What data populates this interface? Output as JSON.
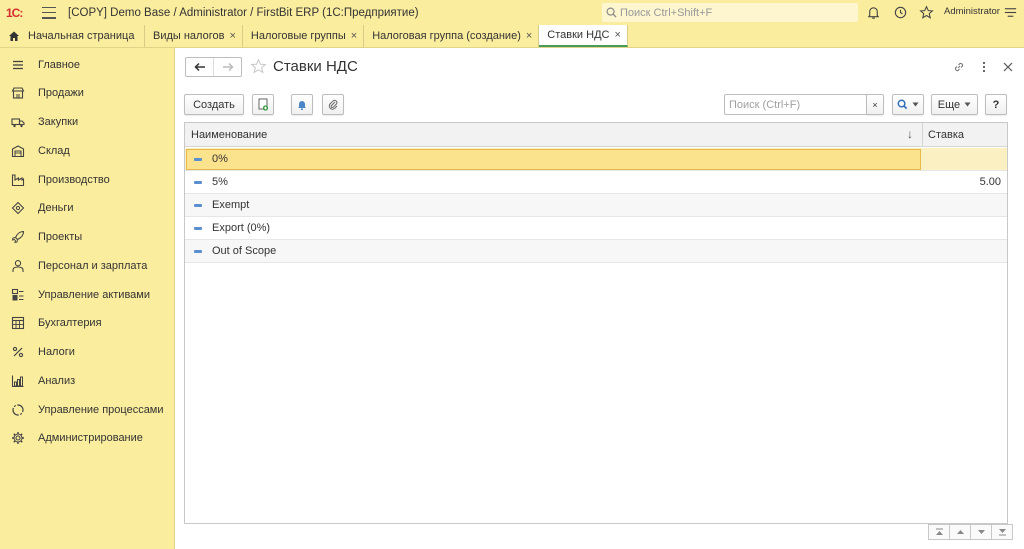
{
  "app": {
    "logo_text": "1С:",
    "title": "[COPY] Demo Base / Administrator / FirstBit ERP  (1С:Предприятие)",
    "search_placeholder": "Поиск Ctrl+Shift+F",
    "user": "Administrator"
  },
  "tabs": [
    {
      "label": "Начальная страница",
      "icon": "home-icon",
      "closable": false
    },
    {
      "label": "Виды налогов",
      "closable": true
    },
    {
      "label": "Налоговые группы",
      "closable": true
    },
    {
      "label": "Налоговая группа (создание)",
      "closable": true
    },
    {
      "label": "Ставки НДС",
      "closable": true,
      "active": true
    }
  ],
  "tab_close_glyph": "×",
  "sidebar": {
    "items": [
      {
        "label": "Главное",
        "icon": "menu-icon"
      },
      {
        "label": "Продажи",
        "icon": "shop-icon"
      },
      {
        "label": "Закупки",
        "icon": "truck-icon"
      },
      {
        "label": "Склад",
        "icon": "warehouse-icon"
      },
      {
        "label": "Производство",
        "icon": "factory-icon"
      },
      {
        "label": "Деньги",
        "icon": "money-icon"
      },
      {
        "label": "Проекты",
        "icon": "rocket-icon"
      },
      {
        "label": "Персонал и зарплата",
        "icon": "person-icon"
      },
      {
        "label": "Управление активами",
        "icon": "assets-icon"
      },
      {
        "label": "Бухгалтерия",
        "icon": "ledger-icon"
      },
      {
        "label": "Налоги",
        "icon": "percent-icon"
      },
      {
        "label": "Анализ",
        "icon": "chart-icon"
      },
      {
        "label": "Управление процессами",
        "icon": "process-icon"
      },
      {
        "label": "Администрирование",
        "icon": "gear-icon"
      }
    ]
  },
  "form": {
    "title": "Ставки НДС",
    "create_label": "Создать",
    "search_placeholder": "Поиск (Ctrl+F)",
    "search_clear": "×",
    "more_label": "Еще",
    "help_label": "?"
  },
  "table": {
    "columns": [
      "Наименование",
      "Ставка"
    ],
    "sort_glyph": "↓",
    "rows": [
      {
        "name": "0%",
        "rate": ""
      },
      {
        "name": "5%",
        "rate": "5.00"
      },
      {
        "name": "Exempt",
        "rate": ""
      },
      {
        "name": "Export (0%)",
        "rate": ""
      },
      {
        "name": "Out of Scope",
        "rate": ""
      }
    ],
    "selected_row": 0
  },
  "colors": {
    "panel": "#fbed9e",
    "selection": "#fbe28c",
    "active_tab_underline": "#4a9a5a",
    "logo_red": "#d32f2f"
  }
}
